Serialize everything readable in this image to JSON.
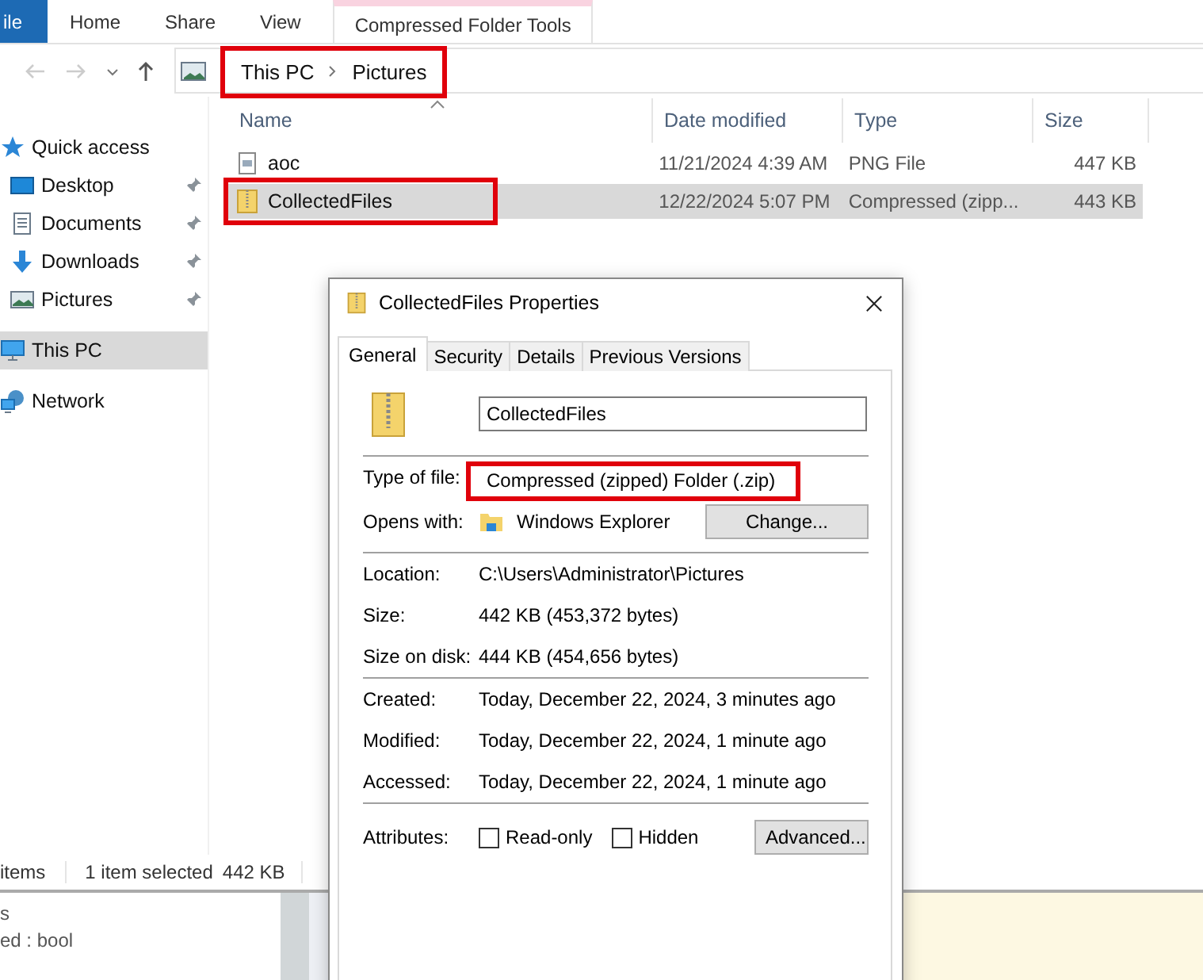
{
  "ribbon": {
    "tabs": [
      {
        "label": "ile",
        "kind": "file"
      },
      {
        "label": "Home",
        "kind": "tab"
      },
      {
        "label": "Share",
        "kind": "tab"
      },
      {
        "label": "View",
        "kind": "tab"
      },
      {
        "label": "Compressed Folder Tools",
        "kind": "contextual"
      }
    ]
  },
  "address_bar": {
    "path": [
      "This PC",
      "Pictures"
    ],
    "highlighted": true
  },
  "navigation_pane": {
    "items": [
      {
        "label": "Quick access",
        "kind": "star",
        "selected": false,
        "children": [
          {
            "label": "Desktop",
            "kind": "desktop",
            "pinned": true,
            "selected": false
          },
          {
            "label": "Documents",
            "kind": "documents",
            "pinned": true,
            "selected": false
          },
          {
            "label": "Downloads",
            "kind": "downloads",
            "pinned": true,
            "selected": false
          },
          {
            "label": "Pictures",
            "kind": "pictures",
            "pinned": true,
            "selected": false
          }
        ]
      },
      {
        "label": "This PC",
        "kind": "pc",
        "selected": true
      },
      {
        "label": "Network",
        "kind": "network",
        "selected": false
      }
    ]
  },
  "file_list": {
    "columns": [
      "Name",
      "Date modified",
      "Type",
      "Size"
    ],
    "rows": [
      {
        "name": "aoc",
        "date_modified": "11/21/2024 4:39 AM",
        "type": "PNG File",
        "size": "447 KB",
        "kind": "image",
        "selected": false,
        "highlighted": false
      },
      {
        "name": "CollectedFiles",
        "date_modified": "12/22/2024 5:07 PM",
        "type": "Compressed (zipp...",
        "size": "443 KB",
        "kind": "zip",
        "selected": true,
        "highlighted": true
      }
    ]
  },
  "status_bar": {
    "item_count": "items",
    "selection": "1 item selected",
    "selection_size": "442 KB"
  },
  "bottom_panel": {
    "lines": [
      "s",
      "ed : bool"
    ]
  },
  "dialog": {
    "title": "CollectedFiles Properties",
    "tabs": [
      {
        "label": "General",
        "selected": true
      },
      {
        "label": "Security",
        "selected": false
      },
      {
        "label": "Details",
        "selected": false
      },
      {
        "label": "Previous Versions",
        "selected": false
      }
    ],
    "name_value": "CollectedFiles",
    "type_of_file": {
      "label": "Type of file:",
      "value": "Compressed (zipped) Folder (.zip)",
      "highlighted": true
    },
    "opens_with": {
      "label": "Opens with:",
      "value": "Windows Explorer",
      "button": "Change..."
    },
    "location_group": [
      {
        "label": "Location:",
        "value": "C:\\Users\\Administrator\\Pictures"
      },
      {
        "label": "Size:",
        "value": "442 KB (453,372 bytes)"
      },
      {
        "label": "Size on disk:",
        "value": "444 KB (454,656 bytes)"
      }
    ],
    "dates_group": [
      {
        "label": "Created:",
        "value": "Today, December 22, 2024, 3 minutes ago"
      },
      {
        "label": "Modified:",
        "value": "Today, December 22, 2024, 1 minute ago"
      },
      {
        "label": "Accessed:",
        "value": "Today, December 22, 2024, 1 minute ago"
      }
    ],
    "attributes": {
      "label": "Attributes:",
      "checkboxes": [
        {
          "label": "Read-only",
          "checked": false
        },
        {
          "label": "Hidden",
          "checked": false
        }
      ],
      "button": "Advanced..."
    }
  }
}
